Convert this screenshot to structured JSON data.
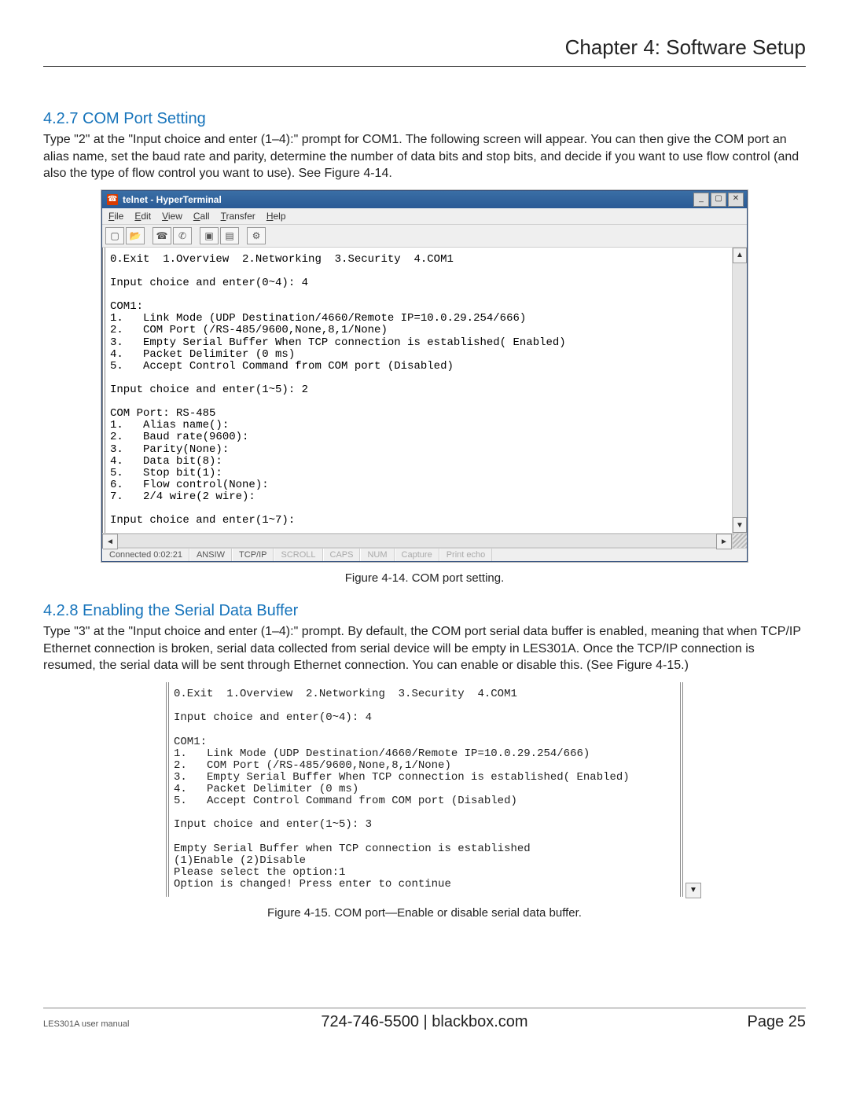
{
  "header": {
    "chapter_title": "Chapter 4: Software Setup"
  },
  "s427": {
    "heading": "4.2.7 COM Port Setting",
    "para": "Type \"2\" at the \"Input choice and enter (1–4):\" prompt for COM1. The following screen will appear. You can then give the COM port an alias name, set the baud rate and parity, determine the number of data bits and stop bits, and decide if you want to use flow control (and also the type of flow control you want to use). See Figure 4-14."
  },
  "figure414_caption": "Figure 4-14. COM port setting.",
  "s428": {
    "heading": "4.2.8 Enabling the Serial Data Buffer",
    "para": "Type \"3\" at the \"Input choice and enter (1–4):\" prompt. By default, the COM port serial data buffer is enabled, meaning that when TCP/IP Ethernet connection is broken, serial data collected from serial device will be empty in LES301A. Once the TCP/IP connection is resumed, the serial data will be sent through Ethernet connection. You can enable or disable this. (See Figure 4-15.)"
  },
  "figure415_caption": "Figure 4-15. COM port—Enable or disable serial data buffer.",
  "ht_window": {
    "title": "telnet - HyperTerminal",
    "menus": [
      "File",
      "Edit",
      "View",
      "Call",
      "Transfer",
      "Help"
    ],
    "status": {
      "connected": "Connected 0:02:21",
      "emulation": "ANSIW",
      "protocol": "TCP/IP",
      "scroll": "SCROLL",
      "caps": "CAPS",
      "num": "NUM",
      "capture": "Capture",
      "printecho": "Print echo"
    },
    "terminal_text": "0.Exit  1.Overview  2.Networking  3.Security  4.COM1\n\nInput choice and enter(0~4): 4\n\nCOM1:\n1.   Link Mode (UDP Destination/4660/Remote IP=10.0.29.254/666)\n2.   COM Port (/RS-485/9600,None,8,1/None)\n3.   Empty Serial Buffer When TCP connection is established( Enabled)\n4.   Packet Delimiter (0 ms)\n5.   Accept Control Command from COM port (Disabled)\n\nInput choice and enter(1~5): 2\n\nCOM Port: RS-485\n1.   Alias name():\n2.   Baud rate(9600):\n3.   Parity(None):\n4.   Data bit(8):\n5.   Stop bit(1):\n6.   Flow control(None):\n7.   2/4 wire(2 wire):\n\nInput choice and enter(1~7):"
  },
  "term2_text": "0.Exit  1.Overview  2.Networking  3.Security  4.COM1\n\nInput choice and enter(0~4): 4\n\nCOM1:\n1.   Link Mode (UDP Destination/4660/Remote IP=10.0.29.254/666)\n2.   COM Port (/RS-485/9600,None,8,1/None)\n3.   Empty Serial Buffer When TCP connection is established( Enabled)\n4.   Packet Delimiter (0 ms)\n5.   Accept Control Command from COM port (Disabled)\n\nInput choice and enter(1~5): 3\n\nEmpty Serial Buffer when TCP connection is established\n(1)Enable (2)Disable\nPlease select the option:1\nOption is changed! Press enter to continue",
  "footer": {
    "manual": "LES301A user manual",
    "center": "724-746-5500    |    blackbox.com",
    "page": "Page 25"
  },
  "winbtn": {
    "min": "_",
    "max": "▢",
    "close": "✕"
  },
  "toolbar_icons": [
    "new-doc-icon",
    "open-icon",
    "connect-icon",
    "disconnect-icon",
    "send-icon",
    "receive-icon",
    "properties-icon"
  ],
  "toolbar_glyphs": [
    "▢",
    "📂",
    "☎",
    "✆",
    "▣",
    "▤",
    "⚙"
  ]
}
